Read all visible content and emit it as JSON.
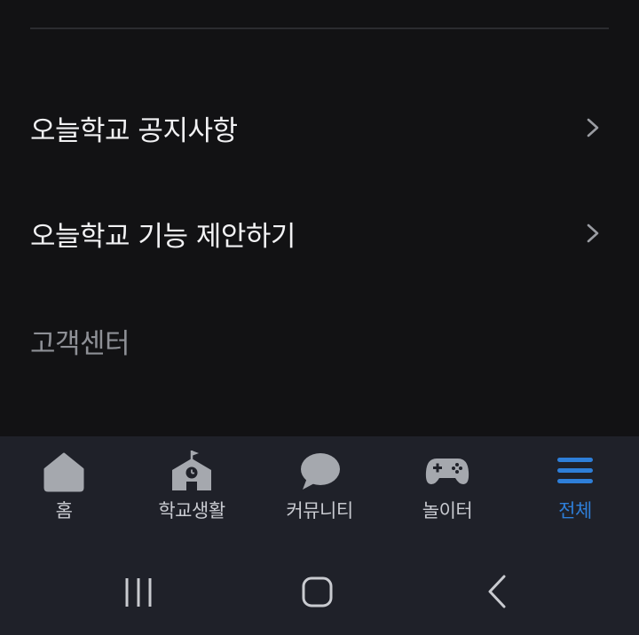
{
  "menu": {
    "items": [
      {
        "label": "오늘학교 공지사항",
        "icon": "chevron-right-icon"
      },
      {
        "label": "오늘학교 기능 제안하기",
        "icon": "chevron-right-icon"
      }
    ],
    "section_heading": "고객센터"
  },
  "tabbar": {
    "tabs": [
      {
        "label": "홈",
        "icon": "home-icon",
        "active": false
      },
      {
        "label": "학교생활",
        "icon": "school-icon",
        "active": false
      },
      {
        "label": "커뮤니티",
        "icon": "chat-bubble-icon",
        "active": false
      },
      {
        "label": "놀이터",
        "icon": "gamepad-icon",
        "active": false
      },
      {
        "label": "전체",
        "icon": "menu-icon",
        "active": true
      }
    ]
  },
  "colors": {
    "background": "#121214",
    "bar": "#1f2129",
    "text_primary": "#f2f2f4",
    "text_muted": "#8e9096",
    "icon_inactive": "#a5a8ae",
    "accent": "#2e7fd9"
  },
  "system_nav": {
    "buttons": [
      "recents-icon",
      "home-circle-icon",
      "back-icon"
    ]
  }
}
